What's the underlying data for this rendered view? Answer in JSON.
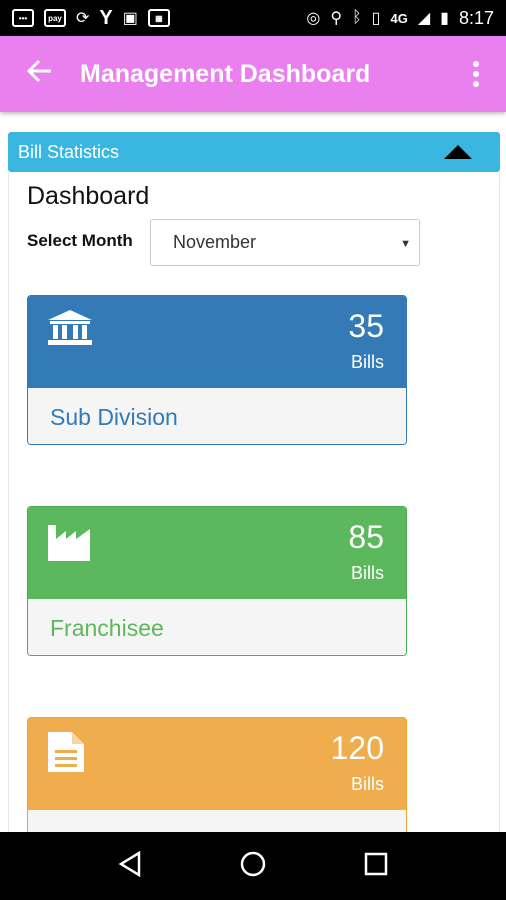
{
  "status_bar": {
    "time": "8:17",
    "network": "4G",
    "left_icons": [
      "chat-icon",
      "paytm-icon",
      "sync-icon",
      "yahoo-icon",
      "tv-icon",
      "app-icon"
    ],
    "right_icons": [
      "hotspot-icon",
      "location-icon",
      "bluetooth-icon",
      "vibrate-icon",
      "signal-icon",
      "battery-icon"
    ]
  },
  "app_bar": {
    "title": "Management Dashboard",
    "back_icon": "arrow-left-icon",
    "menu_icon": "more-vert-icon"
  },
  "section": {
    "title": "Bill Statistics",
    "toggle_icon": "triangle-up-icon"
  },
  "dashboard": {
    "title": "Dashboard",
    "month_label": "Select Month",
    "month_selected": "November"
  },
  "cards": [
    {
      "name": "Sub Division",
      "count": "35",
      "unit": "Bills",
      "icon": "bank-icon",
      "color": "#337ab7",
      "accent": "#337ab7"
    },
    {
      "name": "Franchisee",
      "count": "85",
      "unit": "Bills",
      "icon": "factory-icon",
      "color": "#5cb85c",
      "accent": "#4cae4c"
    },
    {
      "name": "",
      "count": "120",
      "unit": "Bills",
      "icon": "document-icon",
      "color": "#f0ad4e",
      "accent": "#eea236"
    }
  ],
  "nav_bar": {
    "back": "nav-back-icon",
    "home": "nav-home-icon",
    "recents": "nav-recents-icon"
  }
}
